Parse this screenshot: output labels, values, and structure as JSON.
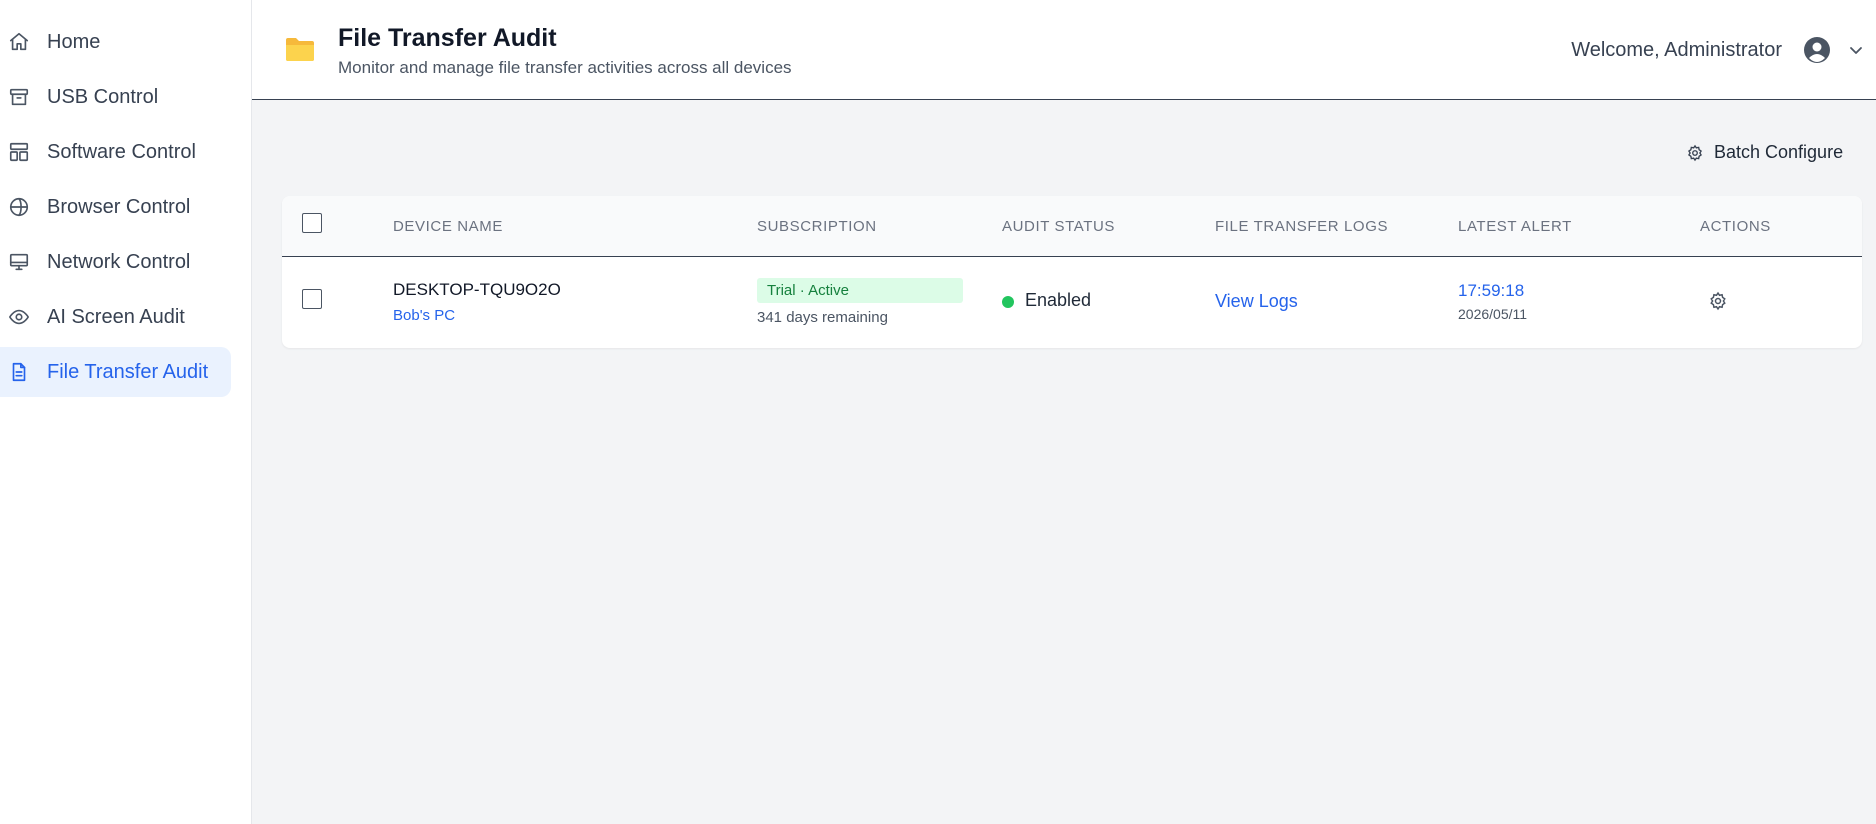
{
  "sidebar": {
    "items": [
      {
        "label": "Home",
        "icon": "home-icon"
      },
      {
        "label": "USB Control",
        "icon": "archive-icon"
      },
      {
        "label": "Software Control",
        "icon": "layout-icon"
      },
      {
        "label": "Browser Control",
        "icon": "globe-icon"
      },
      {
        "label": "Network Control",
        "icon": "monitor-icon"
      },
      {
        "label": "AI Screen Audit",
        "icon": "eye-icon"
      },
      {
        "label": "File Transfer Audit",
        "icon": "file-text-icon",
        "active": true
      }
    ]
  },
  "header": {
    "title": "File Transfer Audit",
    "subtitle": "Monitor and manage file transfer activities across all devices",
    "welcome": "Welcome, Administrator",
    "icon": "folder-icon"
  },
  "toolbar": {
    "batch_label": "Batch Configure"
  },
  "table": {
    "columns": [
      "DEVICE NAME",
      "SUBSCRIPTION",
      "AUDIT STATUS",
      "FILE TRANSFER LOGS",
      "LATEST ALERT",
      "ACTIONS"
    ],
    "rows": [
      {
        "device_name": "DESKTOP-TQU9O2O",
        "device_alias": "Bob's PC",
        "subscription_badge": "Trial · Active",
        "subscription_remaining": "341 days remaining",
        "audit_status": "Enabled",
        "logs_link": "View Logs",
        "alert_time": "17:59:18",
        "alert_date": "2026/05/11"
      }
    ]
  },
  "colors": {
    "accent": "#2563eb",
    "active_bg": "#eaf2fe",
    "status_enabled": "#22c55e",
    "badge_bg": "#dcfce7",
    "badge_text": "#15803d"
  }
}
